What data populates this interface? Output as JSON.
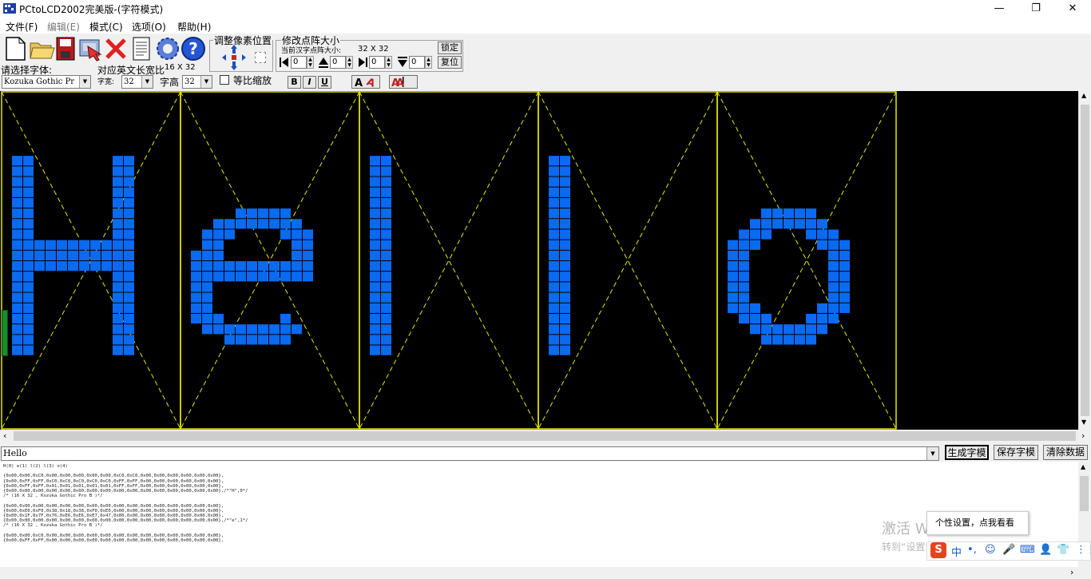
{
  "window": {
    "title": "PCtoLCD2002完美版-(字符模式)",
    "controls": {
      "minimize": "—",
      "maximize": "❐",
      "close": "✕"
    }
  },
  "menu": [
    "文件(F)",
    "编辑(E)",
    "模式(C)",
    "选项(O)",
    "帮助(H)"
  ],
  "toolbar": {
    "pixel_adjust_title": "调整像素位置",
    "matrix_size_title": "修改点阵大小",
    "current_size_label": "当前汉字点阵大小:",
    "current_size_value": "32 X 32",
    "lock_button": "锁定",
    "reset_button": "复位",
    "spin_values": [
      "0",
      "0",
      "0",
      "0"
    ],
    "font_select_label": "请选择字体:",
    "font_value": "Kozuka Gothic Pr",
    "ratio_label": "对应英文长宽比",
    "ratio_value": "16 X 32",
    "char_width_label": "字宽:",
    "char_width_value": "32",
    "char_height_label": "字高",
    "char_height_value": "32",
    "proportional_label": "等比缩放",
    "bold": "B",
    "italic": "I",
    "underline": "U"
  },
  "colors": {
    "pixel": "#0a6af0",
    "grid_line": "#e8e800",
    "canvas_bg": "#000000"
  },
  "canvas": {
    "text": "Hello",
    "glyphs": [
      {
        "char": "H",
        "rows": [
          "",
          "",
          "",
          "",
          "",
          "",
          "11000000011",
          "11000000011",
          "11000000011",
          "11000000011",
          "11000000011",
          "11000000011",
          "11000000011",
          "11000000011",
          "11111111111",
          "11111111111",
          "11111111111",
          "11000000011",
          "11000000011",
          "11000000011",
          "11000000011",
          "11000000011",
          "11000000011",
          "11000000011",
          "11000000011",
          "",
          "",
          "",
          "",
          "",
          "",
          ""
        ]
      },
      {
        "char": "e",
        "rows": [
          "",
          "",
          "",
          "",
          "",
          "",
          "",
          "",
          "",
          "",
          "",
          "00001111100",
          "00111111110",
          "01110000111",
          "01100000011",
          "11100000011",
          "11111111111",
          "11111111111",
          "11000000000",
          "11000000000",
          "11000000000",
          "11100000100",
          "01111111110",
          "00011111100",
          "",
          "",
          "",
          "",
          "",
          "",
          "",
          ""
        ]
      },
      {
        "char": "l",
        "rows": [
          "",
          "",
          "",
          "",
          "",
          "",
          "1100",
          "1100",
          "1100",
          "1100",
          "1100",
          "1100",
          "1100",
          "1100",
          "1100",
          "1100",
          "1100",
          "1100",
          "1100",
          "1100",
          "1100",
          "1100",
          "1100",
          "1100",
          "1100",
          "",
          "",
          "",
          "",
          "",
          "",
          ""
        ]
      },
      {
        "char": "l",
        "rows": [
          "",
          "",
          "",
          "",
          "",
          "",
          "1100",
          "1100",
          "1100",
          "1100",
          "1100",
          "1100",
          "1100",
          "1100",
          "1100",
          "1100",
          "1100",
          "1100",
          "1100",
          "1100",
          "1100",
          "1100",
          "1100",
          "1100",
          "1100",
          "",
          "",
          "",
          "",
          "",
          "",
          ""
        ]
      },
      {
        "char": "o",
        "rows": [
          "",
          "",
          "",
          "",
          "",
          "",
          "",
          "",
          "",
          "",
          "",
          "00011111000",
          "00111111100",
          "01110001110",
          "11100000111",
          "11000000011",
          "11000000011",
          "11000000011",
          "11000000011",
          "11000000011",
          "11100000111",
          "01110001110",
          "00111111100",
          "00011111000",
          "",
          "",
          "",
          "",
          "",
          "",
          "",
          ""
        ]
      }
    ]
  },
  "input": {
    "value": "Hello",
    "generate_button": "生成字模",
    "save_button": "保存字模",
    "clear_button": "清除数据"
  },
  "output_text": "H(0) e(1) l(2) l(3) o(4)\n\n{0x00,0x00,0xC0,0x00,0x00,0x00,0x00,0x00,0xC0,0xC0,0x00,0x00,0x00,0x00,0x00,0x00},\n{0x00,0xFF,0xFF,0xC0,0xC0,0xC0,0xC0,0xC0,0xFF,0xFF,0x00,0x00,0x00,0x00,0x00,0x00},\n{0x00,0xFF,0xFF,0x01,0x01,0x01,0x01,0x01,0xFF,0xFF,0x00,0x00,0x00,0x00,0x00,0x00},\n{0x00,0x00,0x00,0x00,0x00,0x00,0x00,0x00,0x00,0x00,0x00,0x00,0x00,0x00,0x00,0x00},/*\"H\",0*/\n/* (16 X 32 , Kozuka Gothic Pro B )*/\n\n{0x00,0x00,0x00,0x00,0x00,0x00,0x00,0x00,0x00,0x00,0x00,0x00,0x00,0x00,0x00,0x00},\n{0x00,0xE0,0xF0,0x38,0x18,0x38,0xF0,0xE0,0x00,0x00,0x00,0x00,0x00,0x00,0x00,0x00},\n{0x00,0x1F,0x7F,0x76,0xE6,0xE6,0xE7,0x47,0x00,0x00,0x00,0x00,0x00,0x00,0x00,0x00},\n{0x00,0x00,0x00,0x00,0x00,0x00,0x00,0x00,0x00,0x00,0x00,0x00,0x00,0x00,0x00,0x00},/*\"e\",1*/\n/* (16 X 32 , Kozuka Gothic Pro B )*/\n\n{0x00,0x00,0xC0,0x00,0x00,0x00,0x00,0x00,0x00,0x00,0x00,0x00,0x00,0x00,0x00,0x00},\n{0x00,0xFF,0xFF,0x00,0x00,0x00,0x00,0x00,0x00,0x00,0x00,0x00,0x00,0x00,0x00,0x00},",
  "overlay": {
    "popup": "个性设置，点我看看",
    "watermark_line1": "激活 Windows",
    "watermark_line2": "转到“设置”以激活 Windows。",
    "ime": [
      "S",
      "中",
      "•,",
      "☺",
      "🎤",
      "⌨",
      "👤",
      "👕",
      "⋮⋮"
    ]
  }
}
